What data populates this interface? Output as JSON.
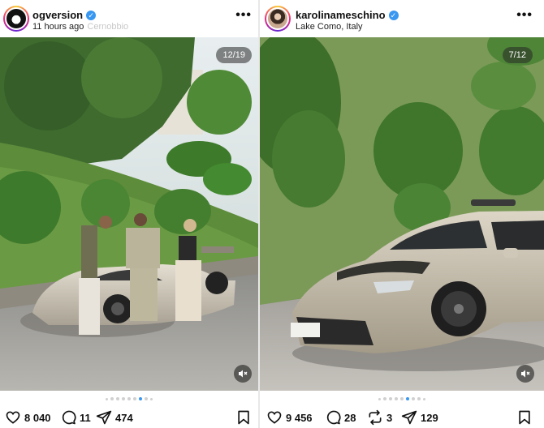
{
  "posts": [
    {
      "username": "ogversion",
      "verified": true,
      "subtitle": "11 hours ago",
      "subtitle_faint": "Cernobbio",
      "media_counter": "12/19",
      "likes": "8 040",
      "comments": "11",
      "shares": "474",
      "carousel_dots": 9,
      "active_dot": 6
    },
    {
      "username": "karolinameschino",
      "verified": true,
      "subtitle": "Lake Como, Italy",
      "media_counter": "7/12",
      "likes": "9 456",
      "comments": "28",
      "reposts": "3",
      "shares": "129",
      "carousel_dots": 9,
      "active_dot": 5
    }
  ],
  "icons": {
    "more": "more-options-icon",
    "verified": "verified-badge-icon",
    "like": "heart-icon",
    "comment": "comment-bubble-icon",
    "repost": "repost-icon",
    "share": "paper-plane-icon",
    "save": "bookmark-icon",
    "mute": "speaker-muted-icon"
  },
  "colors": {
    "verified": "#3897f0",
    "active_dot": "#3897f0",
    "inactive_dot": "#d0d0d0"
  }
}
